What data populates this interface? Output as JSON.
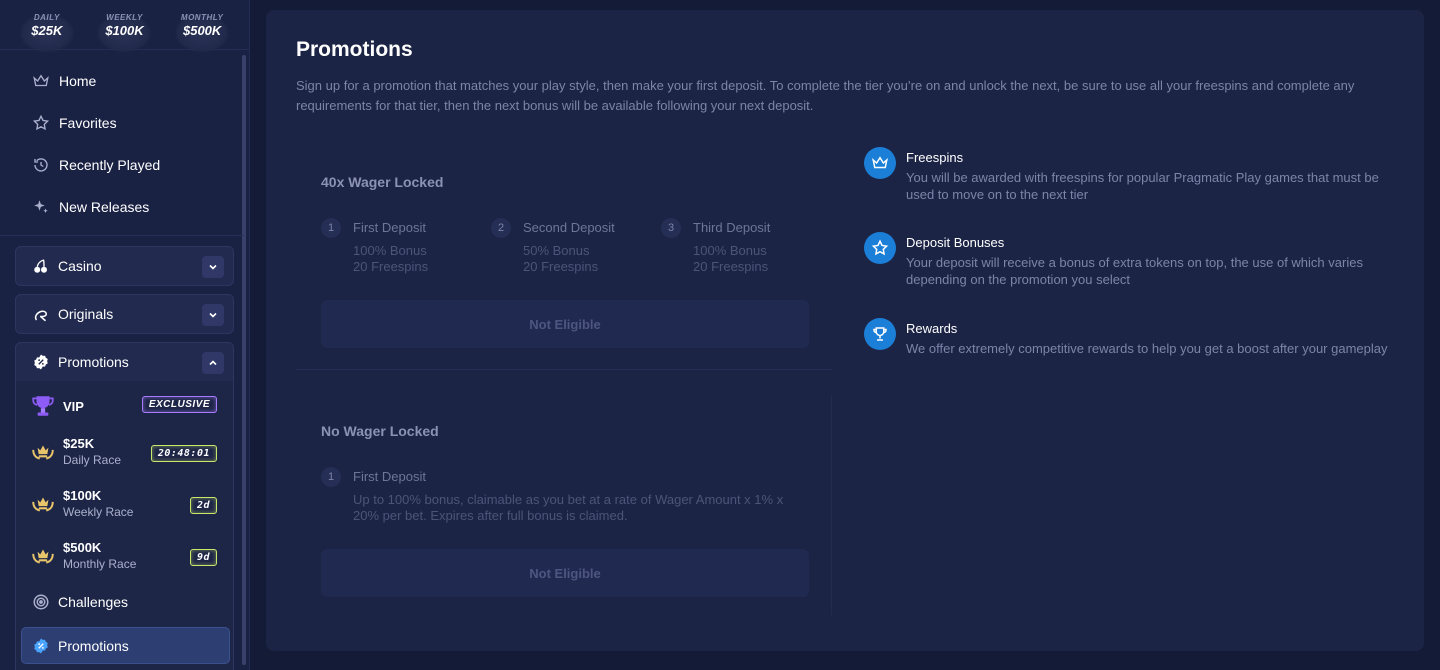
{
  "races_strip": [
    {
      "label": "DAILY",
      "amount": "$25K"
    },
    {
      "label": "WEEKLY",
      "amount": "$100K"
    },
    {
      "label": "MONTHLY",
      "amount": "$500K"
    }
  ],
  "nav": {
    "home": "Home",
    "favorites": "Favorites",
    "recently_played": "Recently Played",
    "new_releases": "New Releases"
  },
  "sections": {
    "casino": "Casino",
    "originals": "Originals",
    "promotions": "Promotions"
  },
  "promotions_menu": {
    "vip_label": "VIP",
    "vip_tag": "EXCLUSIVE",
    "races": [
      {
        "title": "$25K",
        "subtitle": "Daily Race",
        "tag": "20:48:01"
      },
      {
        "title": "$100K",
        "subtitle": "Weekly Race",
        "tag": "2d"
      },
      {
        "title": "$500K",
        "subtitle": "Monthly Race",
        "tag": "9d"
      }
    ],
    "challenges": "Challenges",
    "promotions_active": "Promotions"
  },
  "main": {
    "title": "Promotions",
    "description": "Sign up for a promotion that matches your play style, then make your first deposit. To complete the tier you’re on and unlock the next, be sure to use all your freespins and complete any requirements for that tier, then the next bonus will be available following your next deposit.",
    "card_wager": {
      "title": "40x Wager Locked",
      "steps": [
        {
          "num": "1",
          "title": "First Deposit",
          "line1": "100% Bonus",
          "line2": "20 Freespins"
        },
        {
          "num": "2",
          "title": "Second Deposit",
          "line1": "50% Bonus",
          "line2": "20 Freespins"
        },
        {
          "num": "3",
          "title": "Third Deposit",
          "line1": "100% Bonus",
          "line2": "20 Freespins"
        }
      ],
      "button": "Not Eligible"
    },
    "card_nowager": {
      "title": "No Wager Locked",
      "step": {
        "num": "1",
        "title": "First Deposit",
        "detail": "Up to 100% bonus, claimable as you bet at a rate of Wager Amount x 1% x 20% per bet. Expires after full bonus is claimed."
      },
      "button": "Not Eligible"
    },
    "features": [
      {
        "icon": "crown-icon",
        "title": "Freespins",
        "text": "You will be awarded with freespins for popular Pragmatic Play games that must be used to move on to the next tier"
      },
      {
        "icon": "star-icon",
        "title": "Deposit Bonuses",
        "text": "Your deposit will receive a bonus of extra tokens on top, the use of which varies depending on the promotion you select"
      },
      {
        "icon": "trophy-icon",
        "title": "Rewards",
        "text": "We offer extremely competitive rewards to help you get a boost after your gameplay"
      }
    ]
  },
  "colors": {
    "background": "#141b36",
    "sidebar": "#1a2244",
    "panel": "#1c2445",
    "accent_blue": "#1b7fd8",
    "exclusive_border": "#a77bff",
    "timer_border": "#c9e86a"
  }
}
